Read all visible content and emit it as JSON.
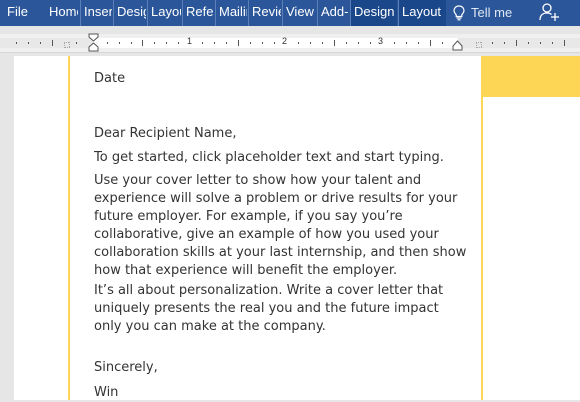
{
  "ribbon": {
    "tabs": [
      {
        "label": "File"
      },
      {
        "label": "Home"
      },
      {
        "label": "Insert"
      },
      {
        "label": "Design"
      },
      {
        "label": "Layout"
      },
      {
        "label": "References"
      },
      {
        "label": "Mailings"
      },
      {
        "label": "Review"
      },
      {
        "label": "View"
      },
      {
        "label": "Add-ins"
      },
      {
        "label": "Design"
      },
      {
        "label": "Layout"
      }
    ],
    "tell_me": "Tell me",
    "accent_color": "#2b579a"
  },
  "ruler": {
    "numbers": [
      "1",
      "2",
      "3"
    ]
  },
  "document": {
    "accent_color": "#fdd655",
    "date": "Date",
    "salutation": "Dear Recipient Name,",
    "para1": [
      "To get started, click placeholder text and start typing."
    ],
    "para2": [
      "Use your cover letter to show how your talent and",
      "experience will solve a problem or drive results for your",
      "future employer. For example, if you say you’re",
      "collaborative, give an example of how you used your",
      "collaboration skills at your last internship, and then show",
      "how that experience will benefit the employer."
    ],
    "para3": [
      "It’s all about personalization. Write a cover letter that",
      "uniquely presents the real you and the future impact",
      "only you can make at the company."
    ],
    "closing": "Sincerely,",
    "signature": "Win"
  }
}
